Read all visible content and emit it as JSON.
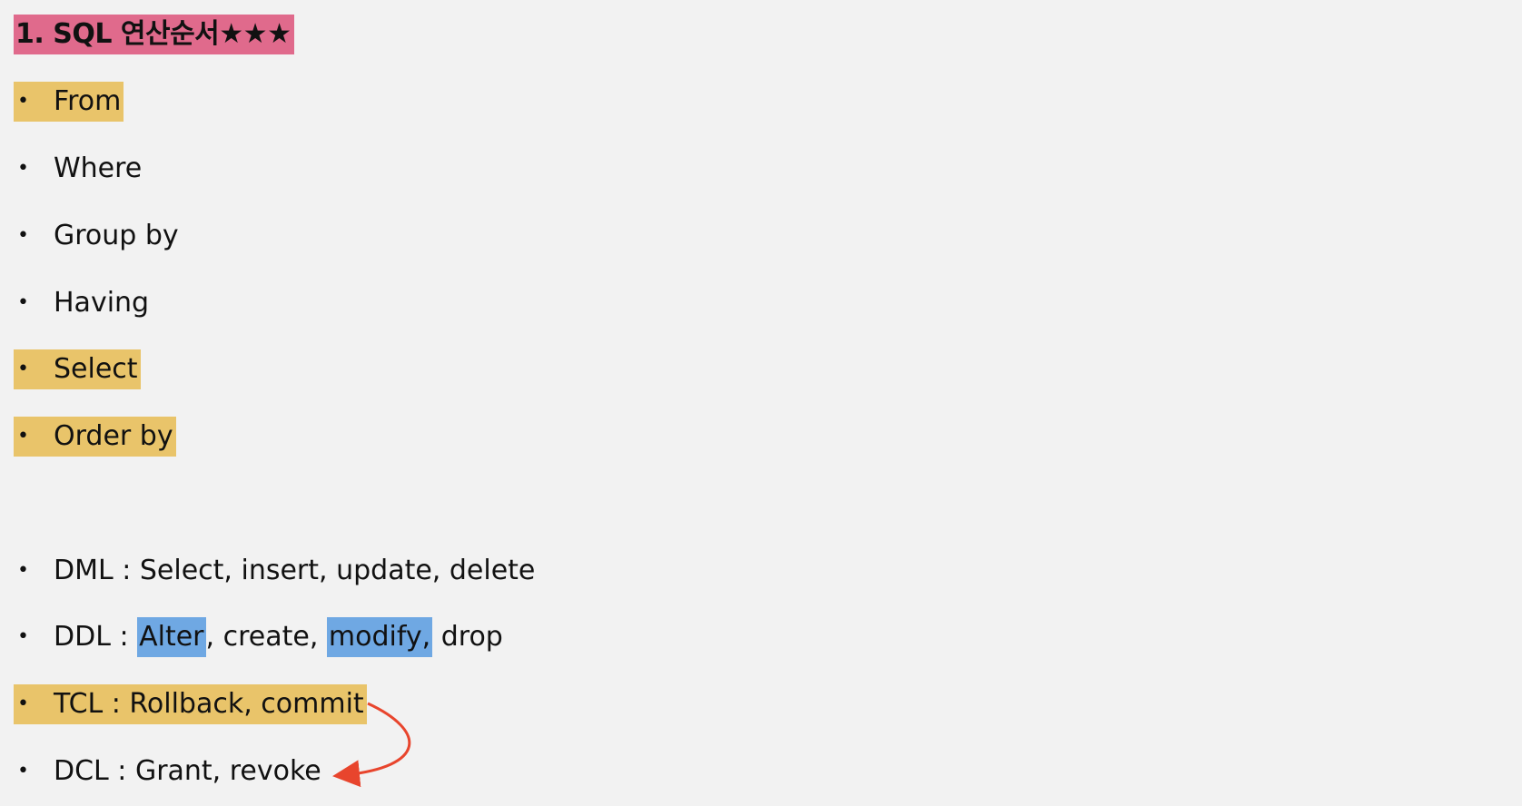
{
  "title": "1. SQL 연산순서★★★",
  "bullet": "•",
  "order_steps": [
    "From",
    "Where",
    "Group by",
    "Having",
    "Select",
    "Order by"
  ],
  "categories": {
    "dml": "DML : Select, insert, update, delete",
    "ddl": {
      "prefix": "DDL : ",
      "alter": "Alter",
      "middle": ", create, ",
      "modify": "modify,",
      "suffix": " drop"
    },
    "tcl": "TCL : Rollback, commit",
    "dcl": "DCL : Grant, revoke"
  },
  "colors": {
    "title_highlight": "#e06a8c",
    "yellow_highlight": "#e9c46a",
    "blue_highlight": "#6fa8e3",
    "arrow": "#e8452d"
  }
}
